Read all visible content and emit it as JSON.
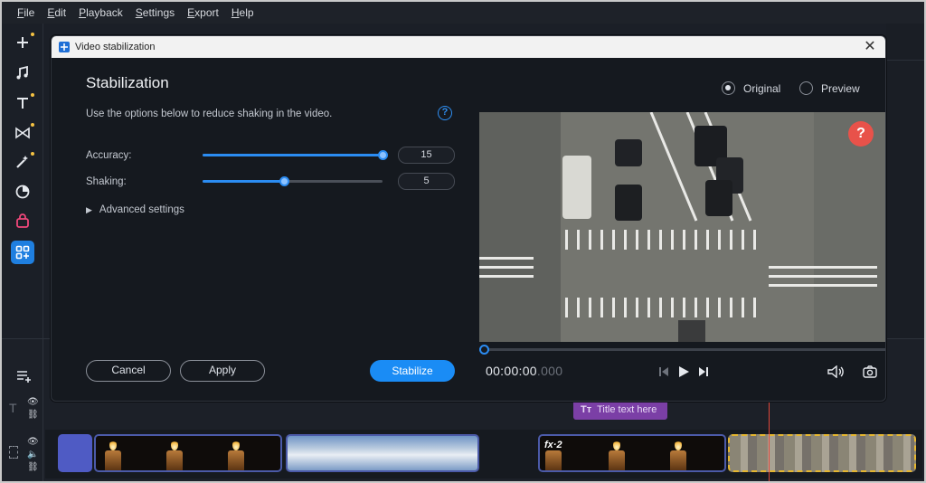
{
  "menu": [
    "File",
    "Edit",
    "Playback",
    "Settings",
    "Export",
    "Help"
  ],
  "menu_underline": [
    "F",
    "E",
    "P",
    "S",
    "E",
    "H"
  ],
  "dialog": {
    "title": "Video stabilization",
    "close_label": "✕",
    "heading": "Stabilization",
    "description": "Use the options below to reduce shaking in the video.",
    "help_label": "?",
    "accuracy_label": "Accuracy:",
    "accuracy_value": "15",
    "accuracy_fraction": 1.0,
    "shaking_label": "Shaking:",
    "shaking_value": "5",
    "shaking_fraction": 0.45,
    "advanced_label": "Advanced settings",
    "cancel_label": "Cancel",
    "apply_label": "Apply",
    "stabilize_label": "Stabilize",
    "view_original": "Original",
    "view_preview": "Preview",
    "selected_view": "Original",
    "time_main": "00:00:00",
    "time_ms": ".000",
    "video_help": "?"
  },
  "timeline": {
    "title_clip": "Title text here",
    "fx_label": "fx·2"
  },
  "colors": {
    "accent": "#1a8cf5",
    "tool_dot": "#f5c242",
    "title_clip": "#7b3fa6",
    "playhead": "#e0473a",
    "selected_clip_border": "#e5b62f"
  },
  "icons": {
    "left_tools": [
      "add-icon",
      "music-icon",
      "text-icon",
      "transitions-icon",
      "magic-icon",
      "timer-icon",
      "stickers-icon",
      "more-tools-icon"
    ]
  }
}
